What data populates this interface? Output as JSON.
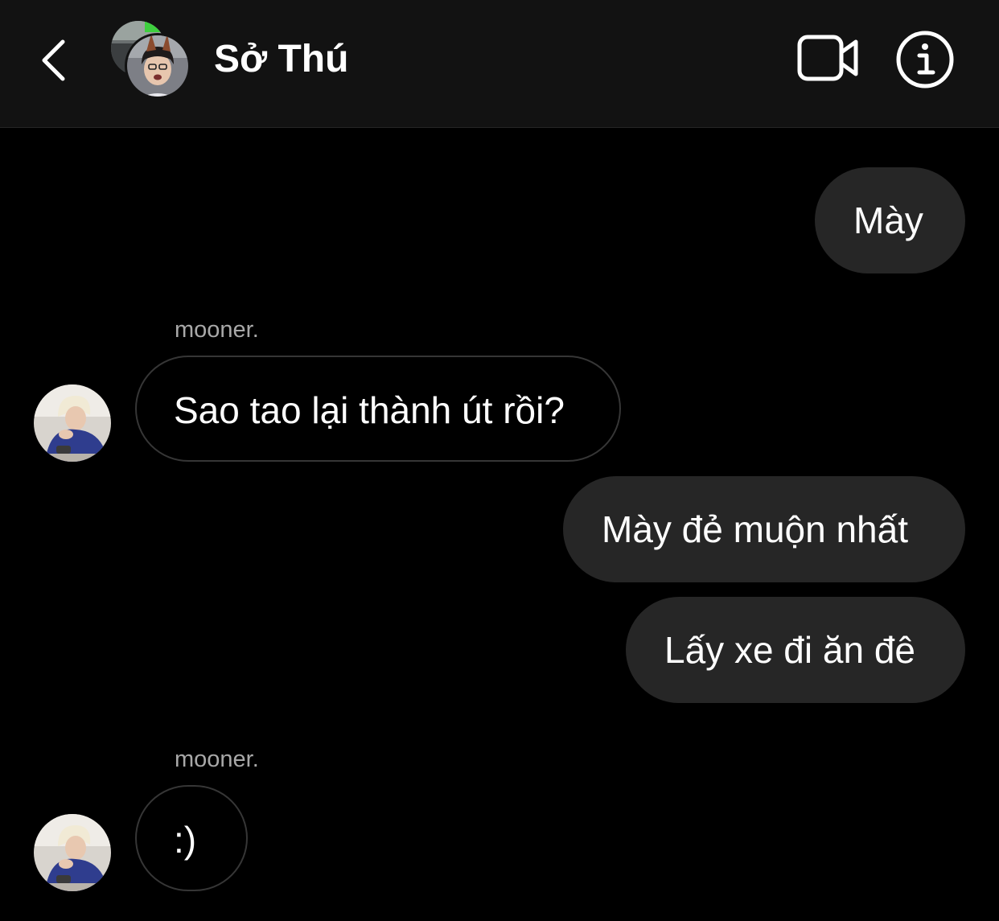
{
  "header": {
    "title": "Sở Thú",
    "back_icon": "chevron-left-icon",
    "video_icon": "video-camera-icon",
    "info_icon": "info-icon"
  },
  "messages": [
    {
      "direction": "outgoing",
      "text": "Mày"
    },
    {
      "direction": "incoming",
      "sender": "mooner.",
      "text": "Sao tao lại thành út rồi?"
    },
    {
      "direction": "outgoing",
      "text": "Mày đẻ muộn nhất"
    },
    {
      "direction": "outgoing",
      "text": "Lấy xe đi ăn đê"
    },
    {
      "direction": "incoming",
      "sender": "mooner.",
      "text": ":)"
    }
  ],
  "colors": {
    "background": "#000000",
    "header_background": "#121212",
    "outgoing_bubble": "#262626",
    "incoming_bubble_border": "#363636",
    "sender_text": "#a8a8a8",
    "active_dot": "#2ecc40"
  }
}
